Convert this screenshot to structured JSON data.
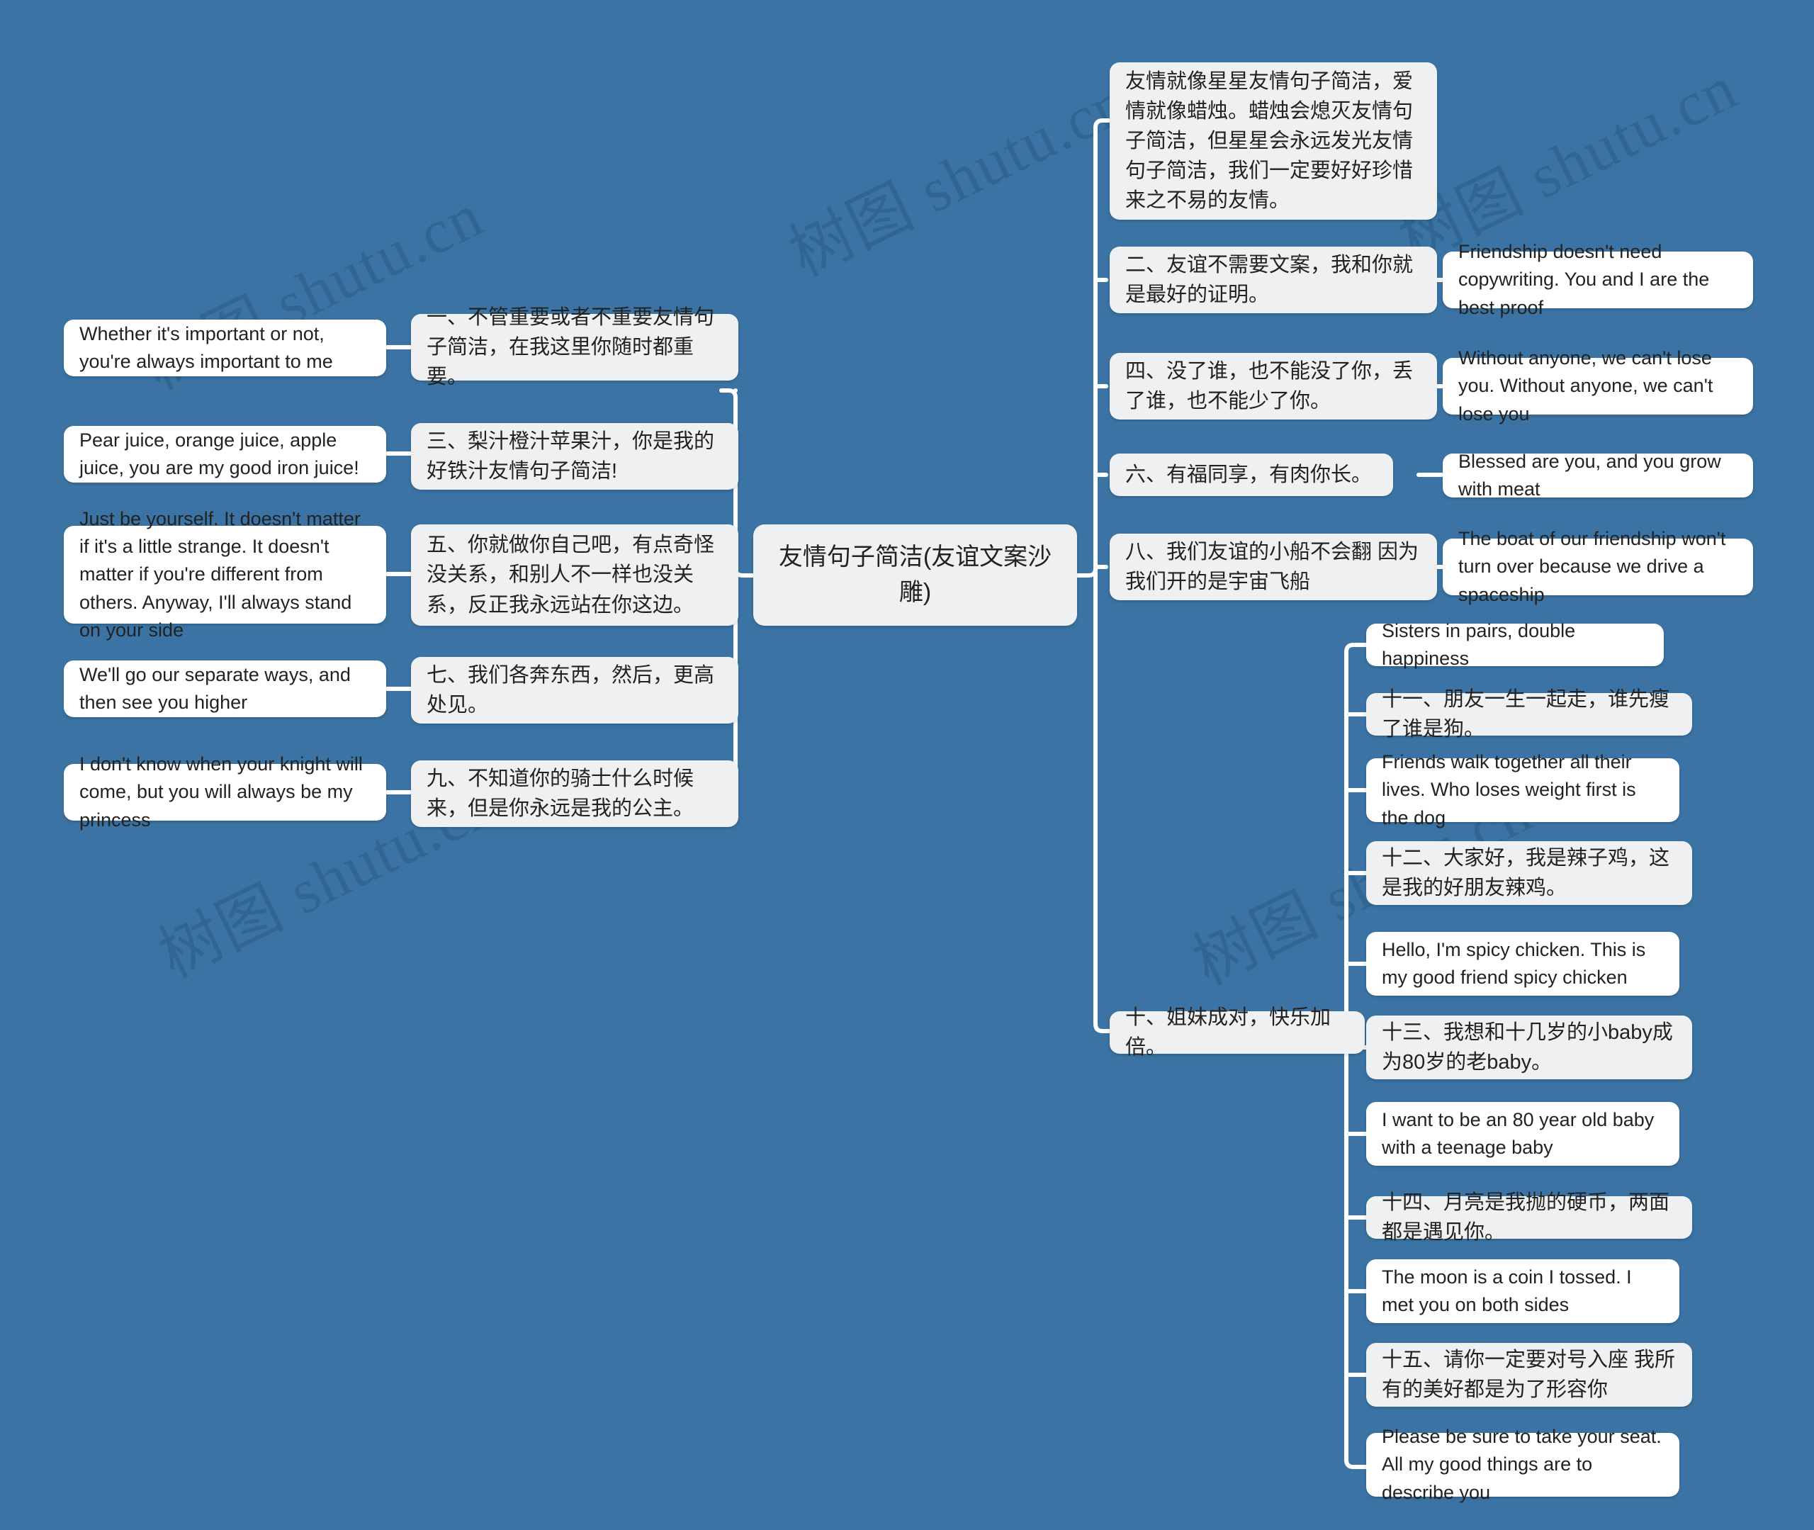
{
  "meta": {
    "background_color": "#3b74a4",
    "node_fill_chinese": "#eff0f1",
    "node_fill_english": "#ffffff",
    "connector_color": "#ffffff",
    "text_color": "#222222"
  },
  "watermark": {
    "text": "树图 shutu.cn",
    "color": "#1c4669"
  },
  "root": {
    "label": "友情句子简洁(友谊文案沙雕)"
  },
  "left_branch": [
    {
      "cn": "一、不管重要或者不重要友情句子简洁，在我这里你随时都重要。",
      "en": "Whether it's important or not, you're always important to me"
    },
    {
      "cn": "三、梨汁橙汁苹果汁，你是我的好铁汁友情句子简洁!",
      "en": "Pear juice, orange juice, apple juice, you are my good iron juice!"
    },
    {
      "cn": "五、你就做你自己吧，有点奇怪没关系，和别人不一样也没关系，反正我永远站在你这边。",
      "en": "Just be yourself. It doesn't matter if it's a little strange. It doesn't matter if you're different from others. Anyway, I'll always stand on your side"
    },
    {
      "cn": "七、我们各奔东西，然后，更高处见。",
      "en": "We'll go our separate ways, and then see you higher"
    },
    {
      "cn": "九、不知道你的骑士什么时候来，但是你永远是我的公主。",
      "en": "I don't know when your knight will come, but you will always be my princess"
    }
  ],
  "right_branch": [
    {
      "cn": "友情就像星星友情句子简洁，爱情就像蜡烛。蜡烛会熄灭友情句子简洁，但星星会永远发光友情句子简洁，我们一定要好好珍惜来之不易的友情。",
      "en": ""
    },
    {
      "cn": "二、友谊不需要文案，我和你就是最好的证明。",
      "en": "Friendship doesn't need copywriting. You and I are the best proof"
    },
    {
      "cn": "四、没了谁，也不能没了你，丢了谁，也不能少了你。",
      "en": "Without anyone, we can't lose you. Without anyone, we can't lose you"
    },
    {
      "cn": "六、有福同享，有肉你长。",
      "en": "Blessed are you, and you grow with meat"
    },
    {
      "cn": "八、我们友谊的小船不会翻 因为我们开的是宇宙飞船",
      "en": "The boat of our friendship won't turn over because we drive a spaceship"
    }
  ],
  "sisters_node": {
    "label": "十、姐妹成对，快乐加倍。"
  },
  "sisters_children": [
    {
      "label": "Sisters in pairs, double happiness"
    },
    {
      "label": "十一、朋友一生一起走，谁先瘦了谁是狗。"
    },
    {
      "label": "Friends walk together all their lives. Who loses weight first is the dog"
    },
    {
      "label": "十二、大家好，我是辣子鸡，这是我的好朋友辣鸡。"
    },
    {
      "label": "Hello, I'm spicy chicken. This is my good friend spicy chicken"
    },
    {
      "label": "十三、我想和十几岁的小baby成为80岁的老baby。"
    },
    {
      "label": "I want to be an 80 year old baby with a teenage baby"
    },
    {
      "label": "十四、月亮是我抛的硬币，两面都是遇见你。"
    },
    {
      "label": "The moon is a coin I tossed. I met you on both sides"
    },
    {
      "label": "十五、请你一定要对号入座 我所有的美好都是为了形容你"
    },
    {
      "label": "Please be sure to take your seat. All my good things are to describe you"
    }
  ]
}
